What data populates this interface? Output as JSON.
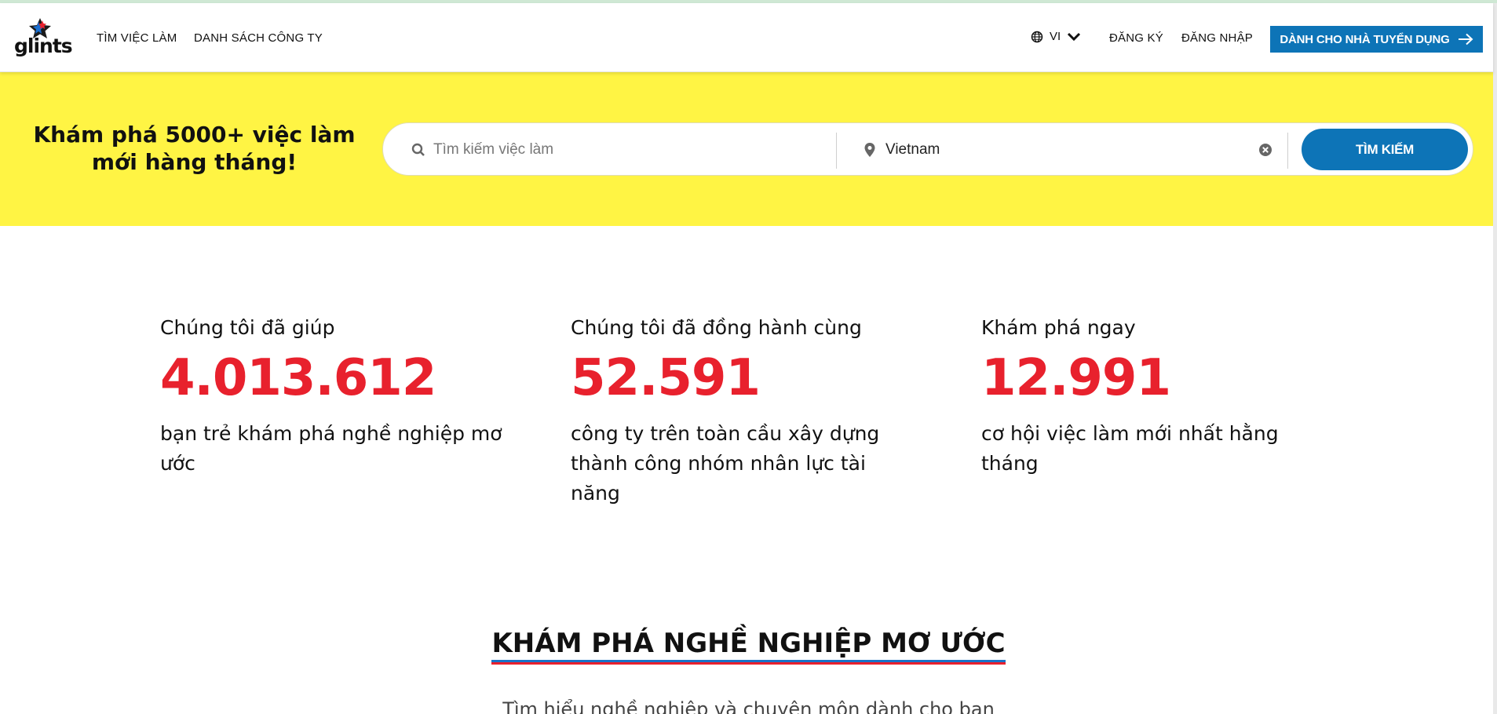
{
  "header": {
    "logo_text": "glints",
    "nav_jobs": "TÌM VIỆC LÀM",
    "nav_companies": "DANH SÁCH CÔNG TY",
    "language": "VI",
    "register": "ĐĂNG KÝ",
    "login": "ĐĂNG NHẬP",
    "employer_button": "DÀNH CHO NHÀ TUYỂN DỤNG"
  },
  "hero": {
    "title_before": "Khám phá ",
    "title_bold": "5000+",
    "title_after": " việc làm mới hàng tháng!",
    "search_placeholder": "Tìm kiếm việc làm",
    "location_value": "Vietnam",
    "search_button": "TÌM KIẾM"
  },
  "stats": [
    {
      "lead": "Chúng tôi đã giúp",
      "number": "4.013.612",
      "desc": "bạn trẻ khám phá nghề nghiệp mơ ước"
    },
    {
      "lead": "Chúng tôi đã đồng hành cùng",
      "number": "52.591",
      "desc": "công ty trên toàn cầu xây dựng thành công nhóm nhân lực tài năng"
    },
    {
      "lead": "Khám phá ngay",
      "number": "12.991",
      "desc": "cơ hội việc làm mới nhất hằng tháng"
    }
  ],
  "section": {
    "title": "KHÁM PHÁ NGHỀ NGHIỆP MƠ ƯỚC",
    "subtitle": "Tìm hiểu nghề nghiệp và chuyên môn dành cho bạn"
  },
  "colors": {
    "brand_blue": "#0d74b7",
    "hero_yellow": "#fff444",
    "stat_red": "#e8212d"
  },
  "icons": [
    "star-logo-icon",
    "globe-icon",
    "chevron-down-icon",
    "arrow-right-icon",
    "search-icon",
    "location-pin-icon",
    "clear-icon"
  ]
}
